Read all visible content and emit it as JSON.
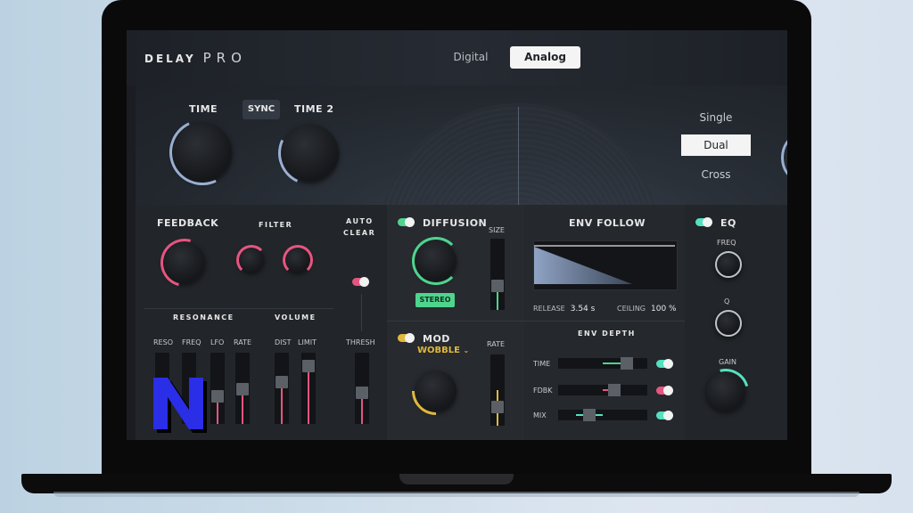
{
  "app": {
    "logo_main": "DELAY",
    "logo_sub": "PRO",
    "modes": [
      "Digital",
      "Analog"
    ],
    "active_mode": "Analog"
  },
  "time_section": {
    "time_label": "TIME",
    "sync_label": "SYNC",
    "time2_label": "TIME 2"
  },
  "routing": {
    "options": [
      "Single",
      "Dual",
      "Cross"
    ],
    "active": "Dual"
  },
  "feedback": {
    "title": "FEEDBACK",
    "filter_label": "FILTER",
    "auto_clear_line1": "AUTO",
    "auto_clear_line2": "CLEAR",
    "thresh_label": "THRESH",
    "resonance_label": "RESONANCE",
    "volume_label": "VOLUME",
    "fader_labels": [
      "RESO",
      "FREQ",
      "LFO",
      "RATE",
      "DIST",
      "LIMIT"
    ]
  },
  "diffusion": {
    "title": "DIFFUSION",
    "size_label": "SIZE",
    "stereo_label": "STEREO",
    "mod_title": "MOD",
    "mod_shape": "WOBBLE",
    "rate_label": "RATE"
  },
  "env_follow": {
    "title": "ENV FOLLOW",
    "release_label": "RELEASE",
    "release_value": "3.54 s",
    "ceiling_label": "CEILING",
    "ceiling_value": "100 %",
    "depth_title": "ENV DEPTH",
    "depth_rows": [
      "TIME",
      "FDBK",
      "MIX"
    ]
  },
  "eq": {
    "title": "EQ",
    "freq_label": "FREQ",
    "q_label": "Q",
    "gain_label": "GAIN"
  },
  "colors": {
    "accent_pink": "#e6557f",
    "accent_green": "#4fd48e",
    "accent_mint": "#55e0c0",
    "accent_yellow": "#e0b83a",
    "accent_blue": "#9aaed0",
    "badge_blue": "#2a2ee6"
  },
  "badge_icon": "n-letter-logo-icon"
}
